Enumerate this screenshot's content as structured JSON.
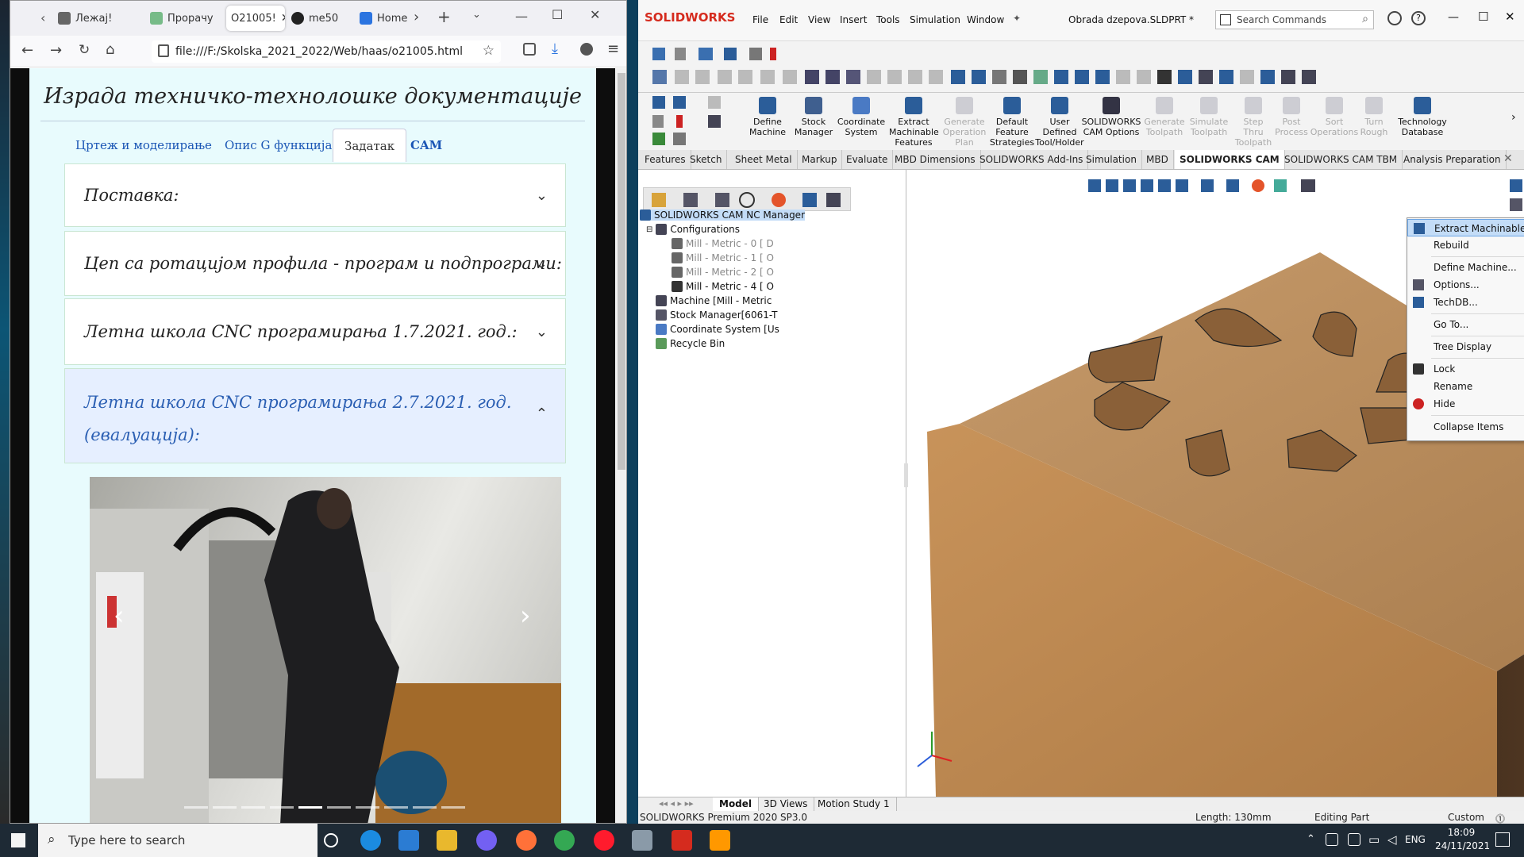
{
  "firefox": {
    "tabs": [
      "Лежај!",
      "Прорачу",
      "O21005!",
      "me50",
      "Home"
    ],
    "url": "file:///F:/Skolska_2021_2022/Web/haas/o21005.html",
    "page": {
      "title": "Израда техничко-технолошке документације",
      "nav_tabs": [
        "Цртеж и моделирање",
        "Опис G функција",
        "Задатак",
        "CAM"
      ],
      "accordion": [
        "Поставка:",
        "Цеп са ротацијом профила - програм и подпрограми:",
        "Летна школа CNC програмирања 1.7.2021. год.:",
        "Летна школа CNC програмирања 2.7.2021. год.",
        "(евалуација):"
      ]
    }
  },
  "solidworks": {
    "brand": "SOLIDWORKS",
    "menu": [
      "File",
      "Edit",
      "View",
      "Insert",
      "Tools",
      "Simulation",
      "Window"
    ],
    "doc_title": "Obrada dzepova.SLDPRT *",
    "search_placeholder": "Search Commands",
    "ribbon": [
      [
        "Define",
        "Machine"
      ],
      [
        "Stock",
        "Manager"
      ],
      [
        "Coordinate",
        "System"
      ],
      [
        "Extract",
        "Machinable",
        "Features"
      ],
      [
        "Generate",
        "Operation",
        "Plan"
      ],
      [
        "Default",
        "Feature",
        "Strategies"
      ],
      [
        "User",
        "Defined",
        "Tool/Holder"
      ],
      [
        "SOLIDWORKS",
        "CAM Options"
      ],
      [
        "Generate",
        "Toolpath"
      ],
      [
        "Simulate",
        "Toolpath"
      ],
      [
        "Step",
        "Thru",
        "Toolpath"
      ],
      [
        "Post",
        "Process"
      ],
      [
        "Sort",
        "Operations"
      ],
      [
        "Turn",
        "Rough"
      ],
      [
        "Technology",
        "Database"
      ]
    ],
    "cm_tabs": [
      "Features",
      "Sketch",
      "Sheet Metal",
      "Markup",
      "Evaluate",
      "MBD Dimensions",
      "SOLIDWORKS Add-Ins",
      "Simulation",
      "MBD",
      "SOLIDWORKS CAM",
      "SOLIDWORKS CAM TBM",
      "Analysis Preparation"
    ],
    "tree": [
      "SOLIDWORKS CAM NC Manager",
      "Configurations",
      "Mill - Metric - 0 [ D",
      "Mill - Metric - 1 [ O",
      "Mill - Metric - 2 [ O",
      "Mill - Metric - 4 [ O",
      "Machine [Mill - Metric",
      "Stock Manager[6061-T",
      "Coordinate System [Us",
      "Recycle Bin"
    ],
    "context_menu": [
      "Extract Machinable Features",
      "Rebuild",
      "Define Machine...",
      "Options...",
      "TechDB...",
      "Go To...",
      "Tree Display",
      "Lock",
      "Rename",
      "Hide",
      "Collapse Items"
    ],
    "bottom_tabs": [
      "Model",
      "3D Views",
      "Motion Study 1"
    ],
    "status": {
      "version": "SOLIDWORKS Premium 2020 SP3.0",
      "length": "Length: 130mm",
      "mode": "Editing Part",
      "units": "Custom"
    }
  },
  "taskbar": {
    "search": "Type here to search",
    "lang": "ENG",
    "time": "18:09",
    "date": "24/11/2021"
  }
}
